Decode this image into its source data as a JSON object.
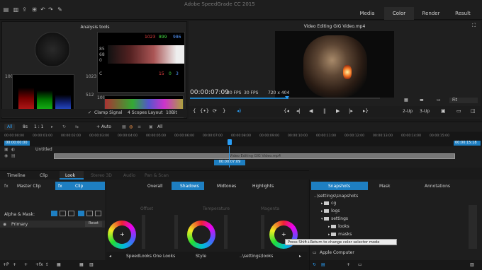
{
  "app": {
    "title": "Adobe SpeedGrade CC 2015"
  },
  "workspace_tabs": [
    {
      "label": "Media",
      "active": false
    },
    {
      "label": "Color",
      "active": true
    },
    {
      "label": "Render",
      "active": false
    },
    {
      "label": "Result",
      "active": false
    }
  ],
  "toolbar_icons": [
    "file-icon",
    "save-icon",
    "export-icon",
    "add-icon",
    "undo-icon",
    "redo-icon",
    "wrench-icon"
  ],
  "analysis": {
    "title": "Analysis tools",
    "rgb_readout": [
      "1023",
      "899",
      "986"
    ],
    "row2": [
      "15",
      "0",
      "3"
    ],
    "scale_left": [
      "100",
      "0"
    ],
    "scale_right": [
      "1023",
      "512",
      "0"
    ],
    "scale_top": [
      "100",
      "0"
    ],
    "label_c": "C",
    "levels": [
      "85",
      "68",
      "0"
    ],
    "clamp_label": "Clamp Signal",
    "layout_label": "4 Scopes Layout",
    "bit_label": "10Bit"
  },
  "monitor": {
    "title": "Video Editing GIG Video.mp4",
    "timecode": "00:00:07:09",
    "fps1": "30 FPS",
    "fps2": "30 FPS",
    "resolution": "720 x 404",
    "fit": "Fit",
    "up2": "2-Up",
    "up3": "3-Up"
  },
  "timeline_toolbar": {
    "all_label": "All",
    "fps_label": "8s",
    "ratio": "1 : 1",
    "auto": "+ Auto",
    "all2": "All"
  },
  "timeline": {
    "ruler": [
      "00:00:00:00",
      "00:00:01:00",
      "00:00:02:00",
      "00:00:03:00",
      "00:00:04:00",
      "00:00:05:00",
      "00:00:06:00",
      "00:00:07:00",
      "00:00:08:00",
      "00:00:09:00",
      "00:00:10:00",
      "00:00:11:00",
      "00:00:12:00",
      "00:00:13:00",
      "00:00:14:00",
      "00:00:15:00"
    ],
    "start_tc": "00:00:00:00",
    "end_tc": "00:00:15:18",
    "untitled": "Untitled",
    "clip_name": "Video Editing GIG Video.mp4",
    "playhead_tc": "00:00:07:09"
  },
  "bottom_tabs": [
    {
      "label": "Timeline",
      "active": false
    },
    {
      "label": "Clip",
      "active": false
    },
    {
      "label": "Look",
      "active": true
    },
    {
      "label": "Stereo 3D",
      "active": false
    },
    {
      "label": "Audio",
      "active": false
    },
    {
      "label": "Pan & Scan",
      "active": false
    }
  ],
  "layers": {
    "master_clip": "Master Clip",
    "clip": "Clip",
    "alpha_mask": "Alpha & Mask:",
    "primary": "Primary",
    "reset": "Reset"
  },
  "grading": {
    "tabs": [
      {
        "label": "Overall",
        "active": false
      },
      {
        "label": "Shadows",
        "active": true
      },
      {
        "label": "Midtones",
        "active": false
      },
      {
        "label": "Highlights",
        "active": false
      }
    ],
    "wheel_labels": [
      "Offset",
      "Temperature",
      "Magenta"
    ],
    "tooltip": "Press Shift+Return to change color selector mode",
    "footer": [
      "SpeedLooks One Looks",
      "Style",
      "..\\settings\\looks"
    ]
  },
  "browser": {
    "tabs": [
      {
        "label": "Snapshots",
        "active": true
      },
      {
        "label": "Mask",
        "active": false
      },
      {
        "label": "Annotations",
        "active": false
      }
    ],
    "path": "..\\settings\\snapshots",
    "tree": [
      {
        "label": "cg",
        "depth": 1,
        "open": false
      },
      {
        "label": "logs",
        "depth": 1,
        "open": false
      },
      {
        "label": "settings",
        "depth": 1,
        "open": true
      },
      {
        "label": "looks",
        "depth": 2,
        "open": false
      },
      {
        "label": "masks",
        "depth": 2,
        "open": false
      },
      {
        "label": "snapshots",
        "depth": 2,
        "open": false
      }
    ],
    "apple": "Apple Computer"
  },
  "colors": {
    "accent": "#1e7fc2",
    "bg": "#1a1a1a",
    "panel": "#222222"
  }
}
